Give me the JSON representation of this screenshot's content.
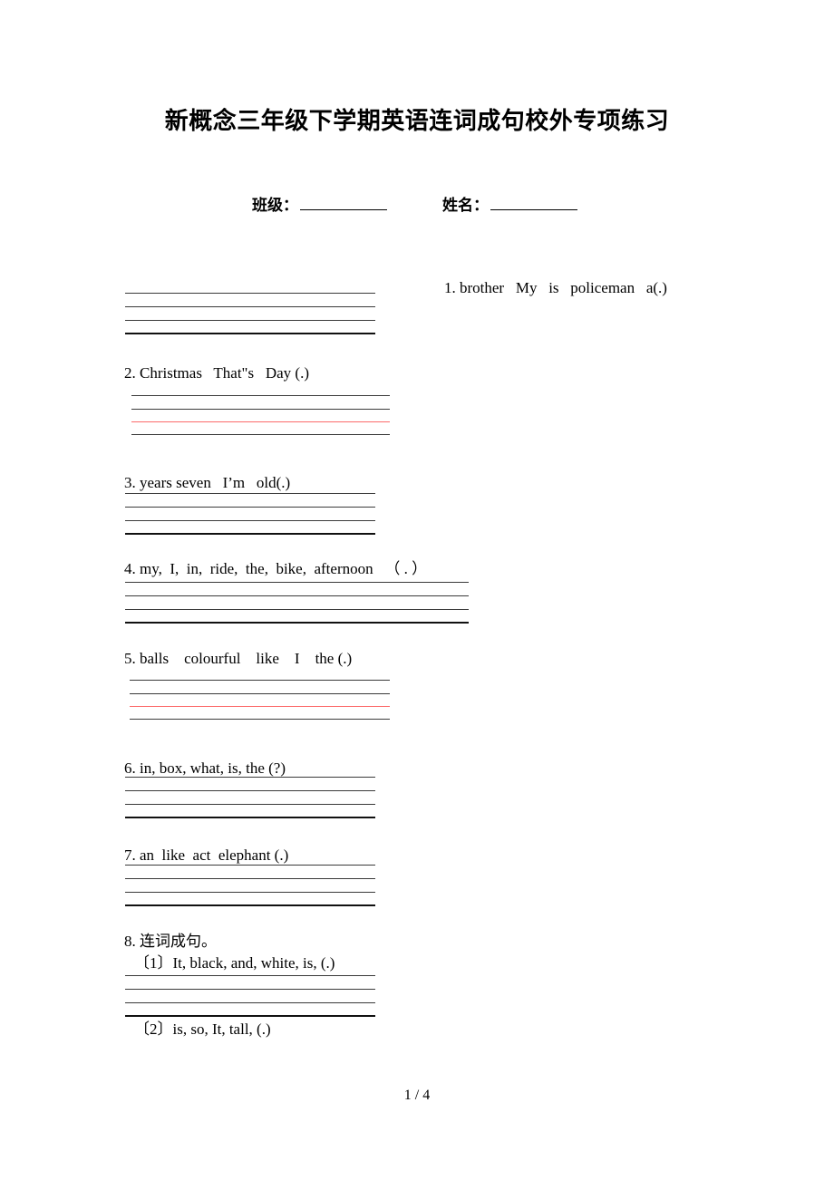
{
  "document": {
    "title": "新概念三年级下学期英语连词成句校外专项练习",
    "footer": "1 / 4"
  },
  "header_fields": {
    "class_label": "班级：",
    "name_label": "姓名："
  },
  "questions": [
    {
      "id": "q1",
      "text": "1. brother   My   is   policeman   a(.)",
      "lines": [
        "black-thin",
        "black-mid",
        "black-mid",
        "black-thick"
      ]
    },
    {
      "id": "q2",
      "text": "2. Christmas   That\"s   Day (.)",
      "lines": [
        "black-thin",
        "black-mid",
        "red",
        "black-mid"
      ]
    },
    {
      "id": "q3",
      "text": "3. years seven   I’m   old(.)",
      "lines": [
        "black-thin",
        "black-mid",
        "black-mid",
        "black-thick"
      ]
    },
    {
      "id": "q4",
      "text": "4. my,  I,  in,  ride,  the,  bike,  afternoon   （ . ）",
      "lines": [
        "black-thin",
        "black-mid",
        "black-mid",
        "black-thick"
      ]
    },
    {
      "id": "q5",
      "text": "5. balls    colourful    like    I    the (.)",
      "lines": [
        "black-thin",
        "black-mid",
        "red",
        "black-mid"
      ]
    },
    {
      "id": "q6",
      "text": "6. in, box, what, is, the (?)",
      "lines": [
        "black-thin",
        "black-mid",
        "black-mid",
        "black-thick"
      ]
    },
    {
      "id": "q7",
      "text": "7. an  like  act  elephant (.)",
      "lines": [
        "black-thin",
        "black-mid",
        "black-mid",
        "black-thick"
      ]
    },
    {
      "id": "q8",
      "text": "8. 连词成句。",
      "sub_items": [
        {
          "id": "q8-1",
          "text": "〔1〕It, black, and, white, is, (.)",
          "lines": [
            "black-thin",
            "black-mid",
            "black-mid",
            "black-thick"
          ]
        },
        {
          "id": "q8-2",
          "text": "〔2〕is, so, It, tall, (.)",
          "lines": []
        }
      ]
    }
  ],
  "colors": {
    "rule_black": "#3a3a3a",
    "rule_black_strong": "#111111",
    "rule_red": "#fc6a6a",
    "page_background": "#ffffff",
    "text": "#000000"
  }
}
